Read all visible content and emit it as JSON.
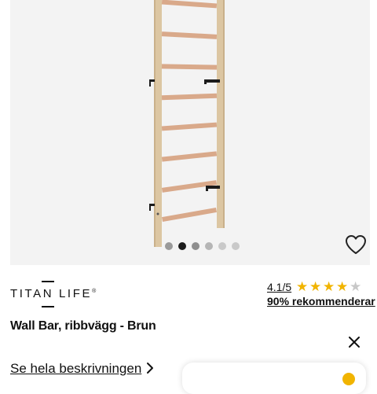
{
  "gallery": {
    "image_alt": "Wall Bar ribbvägg",
    "dot_count": 6,
    "active_index": 1
  },
  "brand": {
    "name": "TITAN LIFE",
    "registered": "®"
  },
  "rating": {
    "score": "4.1/5",
    "stars_filled": 4,
    "stars_total": 5,
    "recommend": "90% rekommenderar"
  },
  "product": {
    "title": "Wall Bar, ribbvägg - Brun"
  },
  "description_link": "Se hela beskrivningen",
  "colors": {
    "star": "#f1b400",
    "gallery_bg": "#f3f3f3"
  },
  "icons": {
    "wishlist": "heart-outline-icon",
    "close": "close-icon",
    "chevron": "chevron-right-icon"
  }
}
